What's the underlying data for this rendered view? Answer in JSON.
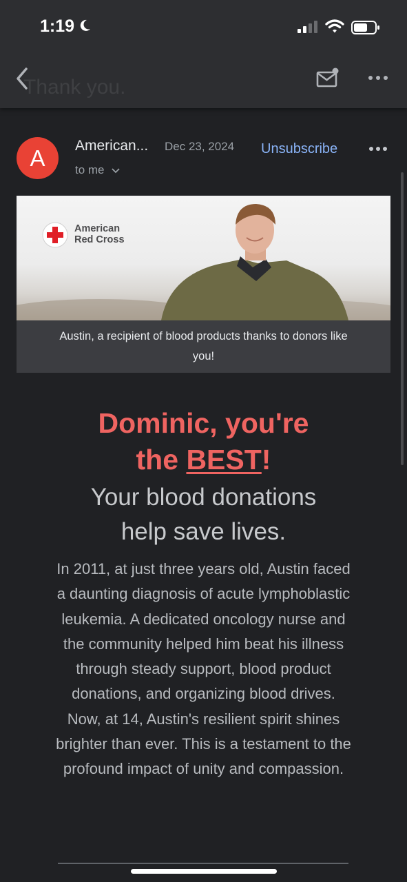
{
  "status_bar": {
    "time": "1:19"
  },
  "toolbar": {
    "subject_ghost": "Thank you."
  },
  "message": {
    "avatar_letter": "A",
    "sender": "American...",
    "date": "Dec 23, 2024",
    "unsubscribe_label": "Unsubscribe",
    "recipient": "to me"
  },
  "hero": {
    "logo_line1": "American",
    "logo_line2": "Red Cross",
    "caption": "Austin, a recipient of blood products thanks to donors like you!"
  },
  "headline": {
    "line1": "Dominic, you're",
    "line2_prefix": "the ",
    "line2_emphasis": "BEST",
    "line2_suffix": "!"
  },
  "subhead": {
    "line1": "Your blood donations",
    "line2": "help save lives."
  },
  "story": "In 2011, at just three years old, Austin faced a daunting diagnosis of acute lymphoblastic leukemia. A dedicated oncology nurse and the community helped him beat his illness through steady support, blood product donations, and organizing blood drives. Now, at 14, Austin's resilient spirit shines brighter than ever. This is a testament to the profound impact of unity and compassion.",
  "colors": {
    "background": "#202124",
    "headline": "#ef6461",
    "link": "#8ab4f8",
    "avatar": "#e94235"
  }
}
